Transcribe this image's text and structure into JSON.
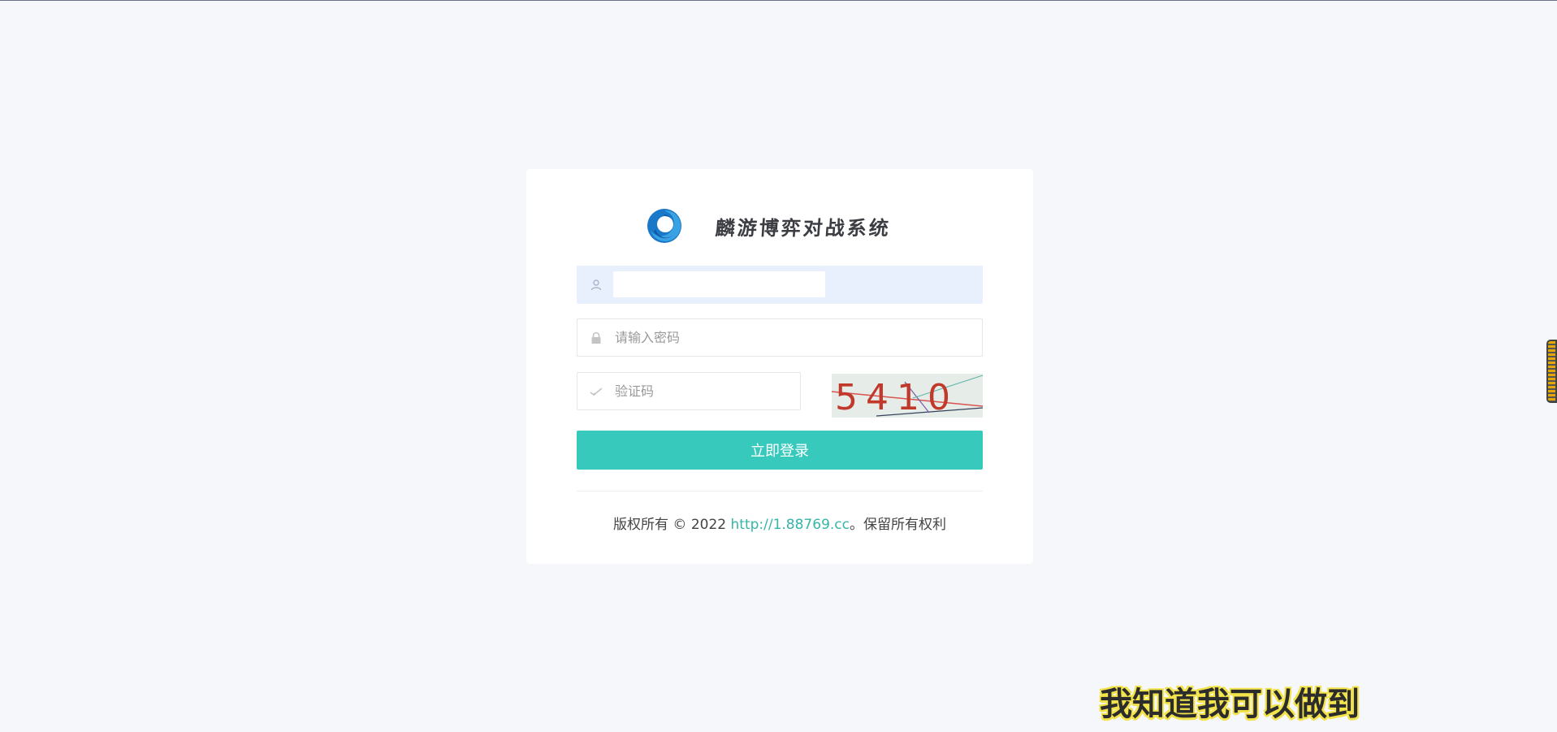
{
  "brand": {
    "title": "麟游博弈对战系统",
    "logo_icon": "swirl-logo-icon"
  },
  "form": {
    "username": {
      "value": "",
      "placeholder": "",
      "icon": "user-icon"
    },
    "password": {
      "value": "",
      "placeholder": "请输入密码",
      "icon": "lock-icon"
    },
    "captcha": {
      "value": "",
      "placeholder": "验证码",
      "icon": "check-icon",
      "image_text": "5410"
    },
    "submit_label": "立即登录"
  },
  "footer": {
    "prefix": "版权所有 © 2022 ",
    "link_text": "http://1.88769.cc",
    "suffix": "。保留所有权利"
  },
  "overlay": {
    "caption": "我知道我可以做到"
  },
  "colors": {
    "accent": "#36c9bc",
    "link": "#36b5a8",
    "page_bg": "#f6f7fb",
    "autofill_bg": "#e8f0fe"
  }
}
